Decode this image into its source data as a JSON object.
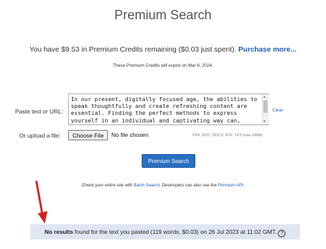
{
  "page": {
    "title": "Premium Search",
    "credits_text": "You have $9.53 in Premium Credits remaining ($0.03 just spent).",
    "purchase_more": "Purchase more...",
    "expire_text": "These Premium Credits will expire on Mar 8, 2024."
  },
  "form": {
    "paste_label": "Paste text or URL:",
    "text_value": "In our present, digitally focused age, the abilities to\nspeak thoughtfully and create refreshing content are\nessential. Finding the perfect methods to express\nyourself in an individual and captivating way can,",
    "clear_label": "Clear",
    "upload_label": "Or upload a file:",
    "choose_file": "Choose File",
    "no_file": "No file chosen",
    "formats": "PDF, DOC, DOCX, RTF, TXT (max 16Mb)",
    "search_button": "Premium Search"
  },
  "footer_note": {
    "prefix": "Check your entire site with ",
    "batch_link": "Batch Search",
    "middle": ". Developers can also use the ",
    "api_link": "Premium API",
    "suffix": "."
  },
  "result": {
    "bold": "No results",
    "rest": " found for the text you pasted (119 words, $0.03) on 26 Jul 2023 at 11:02 GMT.",
    "help_icon_glyph": "?"
  },
  "colors": {
    "link": "#1a5fb4",
    "button": "#2a6ebf",
    "result_bar": "#dfe6f2",
    "annotation_arrow": "#d42020"
  },
  "icons": {
    "help": "question-circle-icon",
    "arrow": "red-arrow-annotation",
    "scroll_up": "scroll-up-arrow-icon",
    "scroll_down": "scroll-down-arrow-icon"
  }
}
